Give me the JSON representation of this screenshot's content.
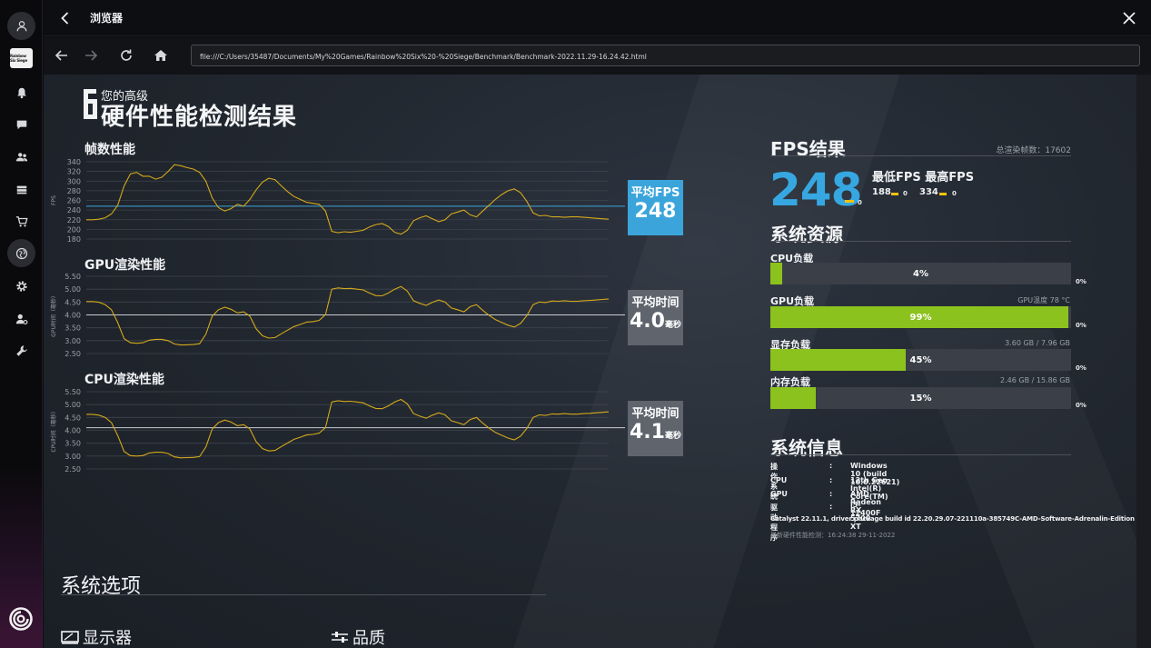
{
  "window": {
    "title": "浏览器"
  },
  "browser": {
    "url": "file:///C:/Users/35487/Documents/My%20Games/Rainbow%20Six%20-%20Siege/Benchmark/Benchmark-2022.11.29-16.24.42.html"
  },
  "sidebar": {
    "game_tile": "Rainbow Six Siege",
    "items": [
      {
        "icon": "bell-icon"
      },
      {
        "icon": "chat-icon"
      },
      {
        "icon": "friends-icon"
      },
      {
        "icon": "library-icon"
      },
      {
        "icon": "cart-icon"
      },
      {
        "icon": "globe-icon",
        "active": true
      },
      {
        "icon": "gear-icon"
      },
      {
        "icon": "user-settings-icon"
      },
      {
        "icon": "wrench-icon"
      }
    ]
  },
  "header": {
    "subtitle": "您的高级",
    "title": "硬件性能检测结果"
  },
  "charts": {
    "fps": {
      "label": "帧数性能",
      "ylabel": "FPS",
      "avg_label": "平均FPS",
      "avg_value": "248",
      "avg_unit": ""
    },
    "gpu": {
      "label": "GPU渲染性能",
      "ylabel": "GPU时间（毫秒）",
      "avg_label": "平均时间",
      "avg_value": "4.0",
      "avg_unit": "毫秒"
    },
    "cpu": {
      "label": "CPU渲染性能",
      "ylabel": "CPU时间（毫秒）",
      "avg_label": "平均时间",
      "avg_value": "4.1",
      "avg_unit": "毫秒"
    }
  },
  "chart_data": [
    {
      "type": "line",
      "title": "帧数性能",
      "ylabel": "FPS",
      "ylim": [
        180,
        340
      ],
      "yticks": [
        180,
        200,
        220,
        240,
        260,
        280,
        300,
        320,
        340
      ],
      "grid": true,
      "average": 248,
      "series": [
        {
          "values": [
            220,
            220,
            221,
            224,
            232,
            250,
            290,
            315,
            318,
            310,
            310,
            304,
            308,
            320,
            334,
            332,
            328,
            325,
            318,
            300,
            265,
            245,
            238,
            243,
            252,
            248,
            262,
            282,
            298,
            306,
            303,
            290,
            278,
            268,
            262,
            256,
            254,
            252,
            238,
            196,
            193,
            195,
            194,
            196,
            198,
            205,
            210,
            212,
            206,
            194,
            190,
            198,
            218,
            224,
            228,
            222,
            216,
            220,
            232,
            236,
            240,
            230,
            226,
            238,
            250,
            262,
            272,
            280,
            284,
            276,
            258,
            234,
            228,
            229,
            226,
            226,
            225,
            226,
            226,
            225,
            224,
            223,
            222,
            221
          ]
        }
      ]
    },
    {
      "type": "line",
      "title": "GPU渲染性能",
      "ylabel": "GPU时间（毫秒）",
      "ylim": [
        2.5,
        5.5
      ],
      "yticks": [
        2.5,
        3.0,
        3.5,
        4.0,
        4.5,
        5.0,
        5.5
      ],
      "grid": true,
      "average": 4.0,
      "series": [
        {
          "values": [
            4.52,
            4.52,
            4.49,
            4.4,
            4.2,
            3.7,
            3.08,
            2.92,
            2.9,
            2.92,
            3.02,
            3.05,
            3.05,
            3.0,
            2.87,
            2.83,
            2.84,
            2.85,
            2.88,
            3.25,
            3.95,
            4.2,
            4.3,
            4.22,
            4.08,
            4.12,
            3.95,
            3.46,
            3.19,
            3.1,
            3.12,
            3.27,
            3.41,
            3.55,
            3.63,
            3.72,
            3.74,
            3.79,
            4.01,
            5.0,
            5.05,
            5.02,
            5.03,
            5.0,
            4.97,
            4.85,
            4.75,
            4.74,
            4.85,
            5.0,
            5.1,
            4.93,
            4.55,
            4.45,
            4.37,
            4.49,
            4.58,
            4.5,
            4.27,
            4.2,
            4.12,
            4.32,
            4.4,
            4.18,
            3.98,
            3.82,
            3.71,
            3.6,
            3.53,
            3.67,
            3.97,
            4.4,
            4.5,
            4.48,
            4.54,
            4.53,
            4.55,
            4.53,
            4.53,
            4.55,
            4.56,
            4.58,
            4.6,
            4.62
          ]
        }
      ]
    },
    {
      "type": "line",
      "title": "CPU渲染性能",
      "ylabel": "CPU时间（毫秒）",
      "ylim": [
        2.5,
        5.5
      ],
      "yticks": [
        2.5,
        3.0,
        3.5,
        4.0,
        4.5,
        5.0,
        5.5
      ],
      "grid": true,
      "average": 4.1,
      "series": [
        {
          "values": [
            4.62,
            4.62,
            4.59,
            4.5,
            4.3,
            3.8,
            3.18,
            3.02,
            3.0,
            3.02,
            3.12,
            3.15,
            3.15,
            3.1,
            2.97,
            2.93,
            2.94,
            2.95,
            2.98,
            3.35,
            4.05,
            4.3,
            4.4,
            4.32,
            4.18,
            4.22,
            4.05,
            3.56,
            3.29,
            3.2,
            3.22,
            3.37,
            3.51,
            3.65,
            3.73,
            3.82,
            3.84,
            3.89,
            4.11,
            5.1,
            5.15,
            5.12,
            5.13,
            5.1,
            5.07,
            4.95,
            4.85,
            4.84,
            4.95,
            5.1,
            5.2,
            5.03,
            4.65,
            4.55,
            4.47,
            4.59,
            4.68,
            4.6,
            4.37,
            4.3,
            4.22,
            4.42,
            4.5,
            4.28,
            4.08,
            3.92,
            3.81,
            3.7,
            3.63,
            3.77,
            4.07,
            4.5,
            4.6,
            4.58,
            4.64,
            4.63,
            4.65,
            4.63,
            4.63,
            4.65,
            4.66,
            4.68,
            4.7,
            4.72
          ]
        }
      ]
    }
  ],
  "fps_result": {
    "title": "FPS结果",
    "total_frames": "总渲染帧数：17602",
    "avg": "248",
    "avg_sub": "0",
    "minmax_label": "最低FPS 最高FPS",
    "min": "188",
    "min_sub": "0",
    "max": "334",
    "max_sub": "0"
  },
  "resources": {
    "title": "系统资源",
    "items": [
      {
        "label": "CPU负载",
        "right": "",
        "percent": 4,
        "pct_text": "4%",
        "zero": "0%"
      },
      {
        "label": "GPU负载",
        "right": "GPU温度 78 °C",
        "percent": 99,
        "pct_text": "99%",
        "zero": "0%"
      },
      {
        "label": "显存负载",
        "right": "3.60 GB / 7.96 GB",
        "percent": 45,
        "pct_text": "45%",
        "zero": "0%"
      },
      {
        "label": "内存负载",
        "right": "2.46 GB / 15.86 GB",
        "percent": 15,
        "pct_text": "15%",
        "zero": "0%"
      }
    ]
  },
  "sysinfo": {
    "title": "系统信息",
    "rows": [
      {
        "key": "操作系统",
        "colon": ":",
        "value": "Windows 10 (build 10.0.22621)"
      },
      {
        "key": "CPU",
        "colon": ":",
        "value": "12th Gen Intel(R) Core(TM) i5-12400F"
      },
      {
        "key": "GPU",
        "colon": ":",
        "value": "AMD Radeon RX 5700 XT"
      },
      {
        "key": "驱动程序",
        "colon": ":",
        "value": ""
      }
    ],
    "driver": "Catalyst 22.11.1, driver package build id 22.20.29.07-221110a-385749C-AMD-Software-Adrenalin-Edition",
    "footer": "最新硬件性能检测：16:24:38 29-11-2022"
  },
  "system_options": {
    "title": "系统选项",
    "display": "显示器",
    "quality": "品质"
  },
  "colors": {
    "fps_blue": "#3ba5db",
    "chart_line": "#d4a91a",
    "load_green": "#8cc21e",
    "avg_marker": "#f4c20d"
  }
}
